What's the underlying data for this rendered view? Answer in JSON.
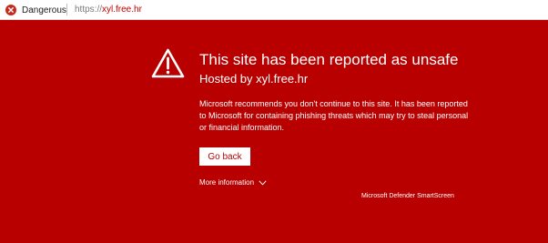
{
  "address_bar": {
    "security_label": "Dangerous",
    "security_icon": "error-circle-icon",
    "url_scheme": "https://",
    "url_host": "xyl.free.hr"
  },
  "warning": {
    "icon": "warning-triangle-icon",
    "title": "This site has been reported as unsafe",
    "subtitle": "Hosted by xyl.free.hr",
    "message": "Microsoft recommends you don't continue to this site. It has been reported to Microsoft for containing phishing threats which may try to steal personal or financial information.",
    "go_back_label": "Go back",
    "more_info_label": "More information",
    "brand": "Microsoft Defender SmartScreen"
  },
  "colors": {
    "background": "#b90000",
    "danger_icon": "#c42b1c",
    "url_host": "#c00000"
  }
}
